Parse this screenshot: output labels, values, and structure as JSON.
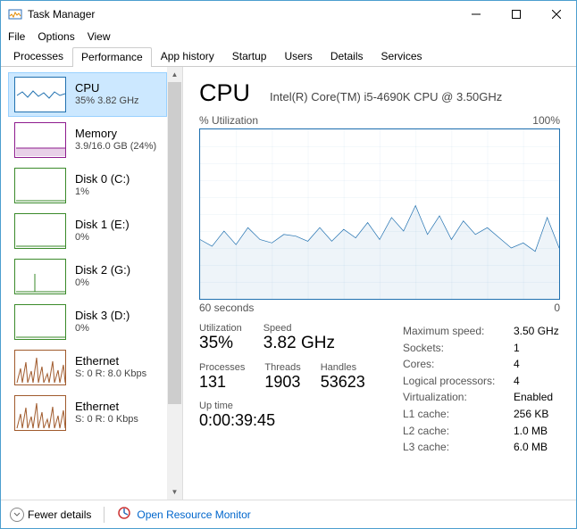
{
  "window": {
    "title": "Task Manager"
  },
  "menu": {
    "items": [
      "File",
      "Options",
      "View"
    ]
  },
  "tabs": [
    "Processes",
    "Performance",
    "App history",
    "Startup",
    "Users",
    "Details",
    "Services"
  ],
  "active_tab": "Performance",
  "sidebar": [
    {
      "name": "CPU",
      "sub": "35% 3.82 GHz",
      "color": "#2171b0",
      "selected": true
    },
    {
      "name": "Memory",
      "sub": "3.9/16.0 GB (24%)",
      "color": "#8e1b8e",
      "selected": false
    },
    {
      "name": "Disk 0 (C:)",
      "sub": "1%",
      "color": "#3a8a2a",
      "selected": false
    },
    {
      "name": "Disk 1 (E:)",
      "sub": "0%",
      "color": "#3a8a2a",
      "selected": false
    },
    {
      "name": "Disk 2 (G:)",
      "sub": "0%",
      "color": "#3a8a2a",
      "selected": false
    },
    {
      "name": "Disk 3 (D:)",
      "sub": "0%",
      "color": "#3a8a2a",
      "selected": false
    },
    {
      "name": "Ethernet",
      "sub": "S: 0 R: 8.0 Kbps",
      "color": "#a05a2c",
      "selected": false
    },
    {
      "name": "Ethernet",
      "sub": "S: 0 R: 0 Kbps",
      "color": "#a05a2c",
      "selected": false
    }
  ],
  "main": {
    "title": "CPU",
    "description": "Intel(R) Core(TM) i5-4690K CPU @ 3.50GHz",
    "chart_top_left": "% Utilization",
    "chart_top_right": "100%",
    "chart_bottom_left": "60 seconds",
    "chart_bottom_right": "0",
    "utilization_label": "Utilization",
    "utilization_value": "35%",
    "speed_label": "Speed",
    "speed_value": "3.82 GHz",
    "processes_label": "Processes",
    "processes_value": "131",
    "threads_label": "Threads",
    "threads_value": "1903",
    "handles_label": "Handles",
    "handles_value": "53623",
    "uptime_label": "Up time",
    "uptime_value": "0:00:39:45",
    "right_stats": [
      {
        "k": "Maximum speed:",
        "v": "3.50 GHz"
      },
      {
        "k": "Sockets:",
        "v": "1"
      },
      {
        "k": "Cores:",
        "v": "4"
      },
      {
        "k": "Logical processors:",
        "v": "4"
      },
      {
        "k": "Virtualization:",
        "v": "Enabled"
      },
      {
        "k": "L1 cache:",
        "v": "256 KB"
      },
      {
        "k": "L2 cache:",
        "v": "1.0 MB"
      },
      {
        "k": "L3 cache:",
        "v": "6.0 MB"
      }
    ]
  },
  "footer": {
    "fewer_details": "Fewer details",
    "open_resmon": "Open Resource Monitor"
  },
  "chart_data": {
    "type": "line",
    "title": "% Utilization",
    "xlabel": "seconds ago",
    "ylabel": "% Utilization",
    "ylim": [
      0,
      100
    ],
    "xlim_label": [
      "60 seconds",
      "0"
    ],
    "x": [
      60,
      58,
      56,
      54,
      52,
      50,
      48,
      46,
      44,
      42,
      40,
      38,
      36,
      34,
      32,
      30,
      28,
      26,
      24,
      22,
      20,
      18,
      16,
      14,
      12,
      10,
      8,
      6,
      4,
      2,
      0
    ],
    "values": [
      35,
      31,
      40,
      32,
      42,
      35,
      33,
      38,
      37,
      34,
      42,
      34,
      41,
      36,
      45,
      35,
      48,
      40,
      55,
      38,
      49,
      35,
      46,
      38,
      42,
      36,
      30,
      33,
      28,
      48,
      30
    ],
    "series": [
      {
        "name": "CPU utilization",
        "values": [
          35,
          31,
          40,
          32,
          42,
          35,
          33,
          38,
          37,
          34,
          42,
          34,
          41,
          36,
          45,
          35,
          48,
          40,
          55,
          38,
          49,
          35,
          46,
          38,
          42,
          36,
          30,
          33,
          28,
          48,
          30
        ]
      }
    ]
  }
}
